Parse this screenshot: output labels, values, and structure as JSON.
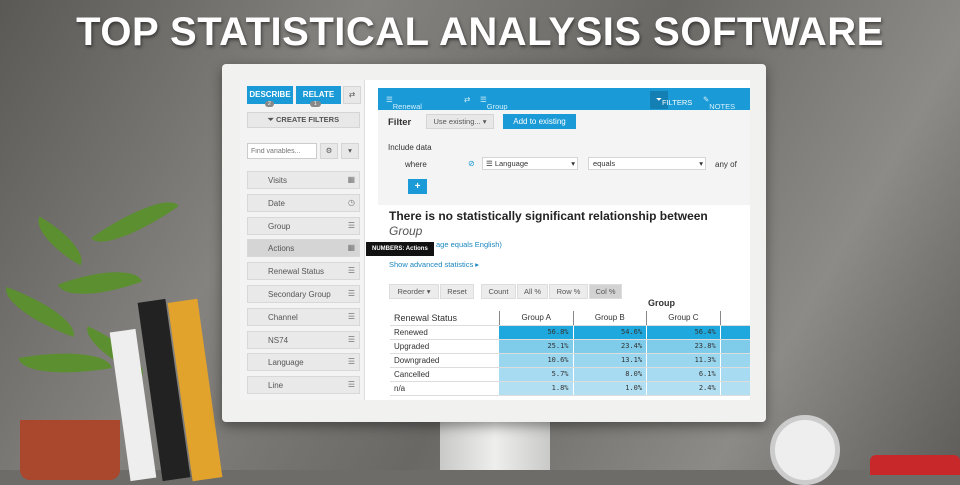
{
  "banner_title": "TOP STATISTICAL ANALYSIS SOFTWARE",
  "sidebar": {
    "describe": "DESCRIBE",
    "describe_badge": "2",
    "relate": "RELATE",
    "relate_badge": "1",
    "create_filters": "CREATE FILTERS",
    "search_placeholder": "Find variables...",
    "variables": [
      {
        "label": "Visits",
        "icon": "numeric-icon"
      },
      {
        "label": "Date",
        "icon": "clock-icon"
      },
      {
        "label": "Group",
        "icon": "categorical-icon"
      },
      {
        "label": "Actions",
        "icon": "numeric-icon"
      },
      {
        "label": "Renewal Status",
        "icon": "categorical-icon"
      },
      {
        "label": "Secondary Group",
        "icon": "categorical-icon"
      },
      {
        "label": "Channel",
        "icon": "categorical-icon"
      },
      {
        "label": "NS74",
        "icon": "categorical-icon"
      },
      {
        "label": "Language",
        "icon": "categorical-icon"
      },
      {
        "label": "Line",
        "icon": "categorical-icon"
      }
    ],
    "tooltip": "NUMBERS: Actions"
  },
  "header": {
    "row_var": "Renewal Status",
    "col_var": "Group",
    "filters": "FILTERS",
    "notes": "NOTES"
  },
  "filter": {
    "label": "Filter",
    "use_existing": "Use existing...",
    "add": "Add to existing",
    "include": "Include data",
    "where": "where",
    "variable": "Language",
    "operator": "equals",
    "any_of": "any of",
    "plus": "+"
  },
  "result": {
    "heading": "There is no statistically significant relationship between",
    "heading_var": "Group",
    "subtext": "age equals English)",
    "advanced": "Show advanced statistics"
  },
  "toolbar": [
    "Reorder",
    "Reset",
    "Count",
    "All %",
    "Row %",
    "Col %"
  ],
  "table": {
    "group_label": "Group",
    "row_header": "Renewal Status",
    "columns": [
      "Group A",
      "Group B",
      "Group C"
    ],
    "rows": [
      {
        "label": "Renewed",
        "values": [
          "56.8%",
          "54.6%",
          "56.4%"
        ]
      },
      {
        "label": "Upgraded",
        "values": [
          "25.1%",
          "23.4%",
          "23.8%"
        ]
      },
      {
        "label": "Downgraded",
        "values": [
          "10.6%",
          "13.1%",
          "11.3%"
        ]
      },
      {
        "label": "Cancelled",
        "values": [
          "5.7%",
          "8.0%",
          "6.1%"
        ]
      },
      {
        "label": "n/a",
        "values": [
          "1.8%",
          "1.0%",
          "2.4%"
        ]
      }
    ]
  },
  "colors": {
    "accent": "#1a9ad6"
  }
}
